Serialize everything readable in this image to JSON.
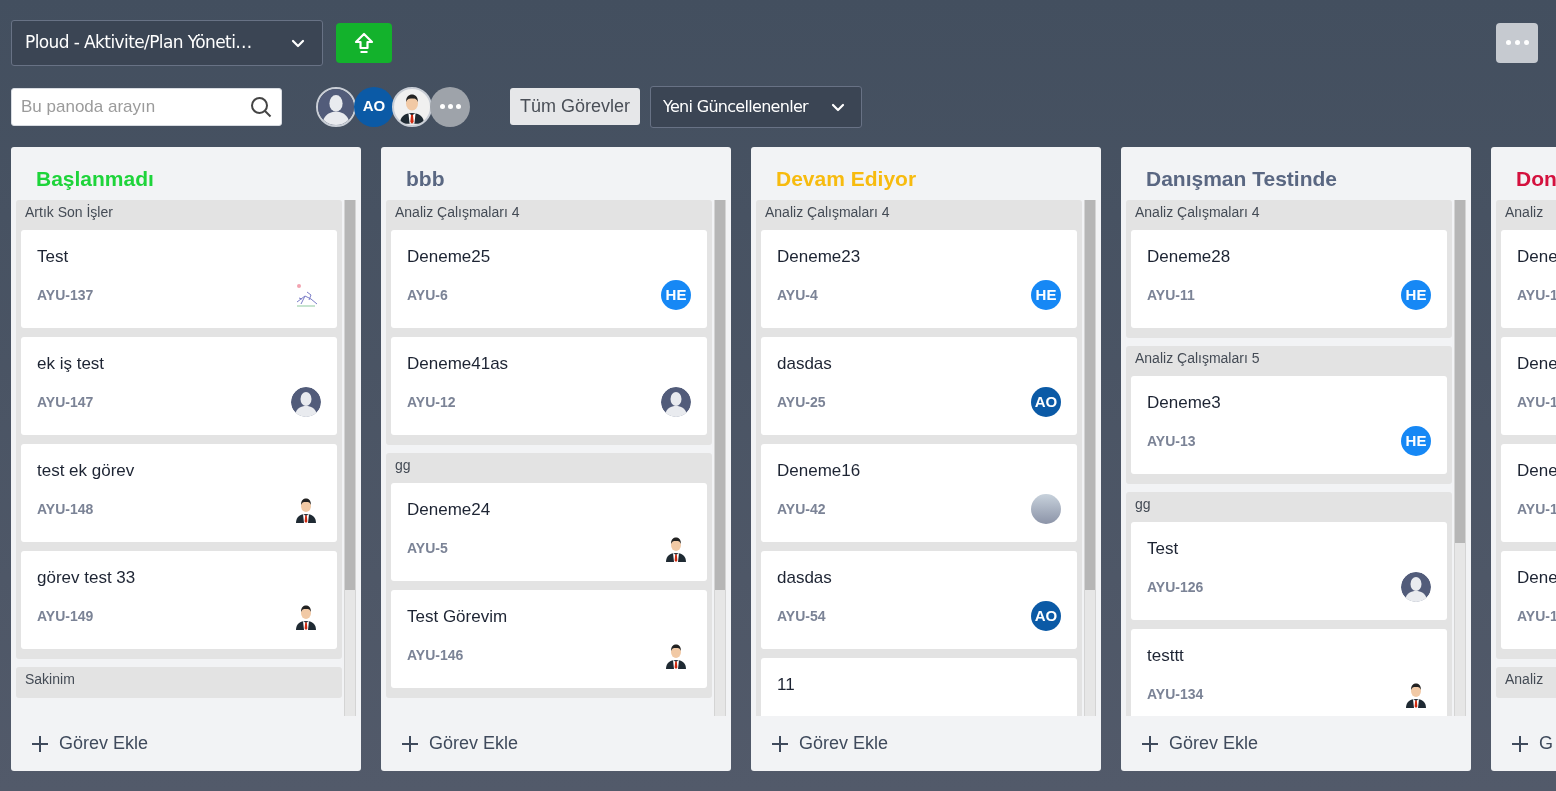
{
  "board_select": {
    "value": "Ploud - Aktivite/Plan Yöneti…"
  },
  "search": {
    "placeholder": "Bu panoda arayın"
  },
  "members": [
    {
      "kind": "silhouette"
    },
    {
      "kind": "initials",
      "text": "AO",
      "color": "#0b5aa6"
    },
    {
      "kind": "businessman"
    },
    {
      "kind": "more"
    }
  ],
  "filter_button": "Tüm Görevler",
  "sort_select": {
    "value": "Yeni Güncellenenler"
  },
  "columns": [
    {
      "title": "Başlanmadı",
      "color": "#1ed43a",
      "add_label": "Görev Ekle",
      "groups": [
        {
          "title": "Artık Son İşler",
          "cards": [
            {
              "title": "Test",
              "id": "AYU-137",
              "avatar": {
                "kind": "sketch"
              }
            },
            {
              "title": "ek iş test",
              "id": "AYU-147",
              "avatar": {
                "kind": "silhouette"
              }
            },
            {
              "title": "test ek görev",
              "id": "AYU-148",
              "avatar": {
                "kind": "businessman"
              }
            },
            {
              "title": "görev test 33",
              "id": "AYU-149",
              "avatar": {
                "kind": "businessman"
              }
            }
          ]
        },
        {
          "title": "Sakinim"
        }
      ]
    },
    {
      "title": "bbb",
      "color": "#5a6782",
      "add_label": "Görev Ekle",
      "groups": [
        {
          "title": "Analiz Çalışmaları 4",
          "cards": [
            {
              "title": "Deneme25",
              "id": "AYU-6",
              "avatar": {
                "kind": "initials",
                "text": "HE",
                "color": "#1688f5"
              }
            },
            {
              "title": "Deneme41as",
              "id": "AYU-12",
              "avatar": {
                "kind": "silhouette"
              }
            }
          ]
        },
        {
          "title": "gg",
          "cards": [
            {
              "title": "Deneme24",
              "id": "AYU-5",
              "avatar": {
                "kind": "businessman"
              }
            },
            {
              "title": "Test Görevim",
              "id": "AYU-146",
              "avatar": {
                "kind": "businessman"
              }
            }
          ]
        }
      ]
    },
    {
      "title": "Devam Ediyor",
      "color": "#f7bb0f",
      "add_label": "Görev Ekle",
      "groups": [
        {
          "title": "Analiz Çalışmaları 4",
          "cards": [
            {
              "title": "Deneme23",
              "id": "AYU-4",
              "avatar": {
                "kind": "initials",
                "text": "HE",
                "color": "#1688f5"
              }
            },
            {
              "title": "dasdas",
              "id": "AYU-25",
              "avatar": {
                "kind": "initials",
                "text": "AO",
                "color": "#0b5aa6"
              }
            },
            {
              "title": "Deneme16",
              "id": "AYU-42",
              "avatar": {
                "kind": "photo"
              }
            },
            {
              "title": "dasdas",
              "id": "AYU-54",
              "avatar": {
                "kind": "initials",
                "text": "AO",
                "color": "#0b5aa6"
              }
            },
            {
              "title": "11"
            }
          ]
        }
      ]
    },
    {
      "title": "Danışman Testinde",
      "color": "#5a6782",
      "add_label": "Görev Ekle",
      "groups": [
        {
          "title": "Analiz Çalışmaları 4",
          "cards": [
            {
              "title": "Deneme28",
              "id": "AYU-11",
              "avatar": {
                "kind": "initials",
                "text": "HE",
                "color": "#1688f5"
              }
            }
          ]
        },
        {
          "title": "Analiz Çalışmaları 5",
          "cards": [
            {
              "title": "Deneme3",
              "id": "AYU-13",
              "avatar": {
                "kind": "initials",
                "text": "HE",
                "color": "#1688f5"
              }
            }
          ]
        },
        {
          "title": "gg",
          "cards": [
            {
              "title": "Test",
              "id": "AYU-126",
              "avatar": {
                "kind": "silhouette"
              }
            },
            {
              "title": "testtt",
              "id": "AYU-134",
              "avatar": {
                "kind": "businessman"
              }
            }
          ]
        }
      ]
    },
    {
      "title": "Don",
      "color": "#d4113e",
      "add_label": "G",
      "groups": [
        {
          "title": "Analiz",
          "cards": [
            {
              "title": "Dene",
              "id": "AYU-1"
            },
            {
              "title": "Dene",
              "id": "AYU-1"
            },
            {
              "title": "Dene",
              "id": "AYU-1"
            },
            {
              "title": "Dene",
              "id": "AYU-1"
            }
          ]
        },
        {
          "title": "Analiz"
        }
      ]
    }
  ]
}
